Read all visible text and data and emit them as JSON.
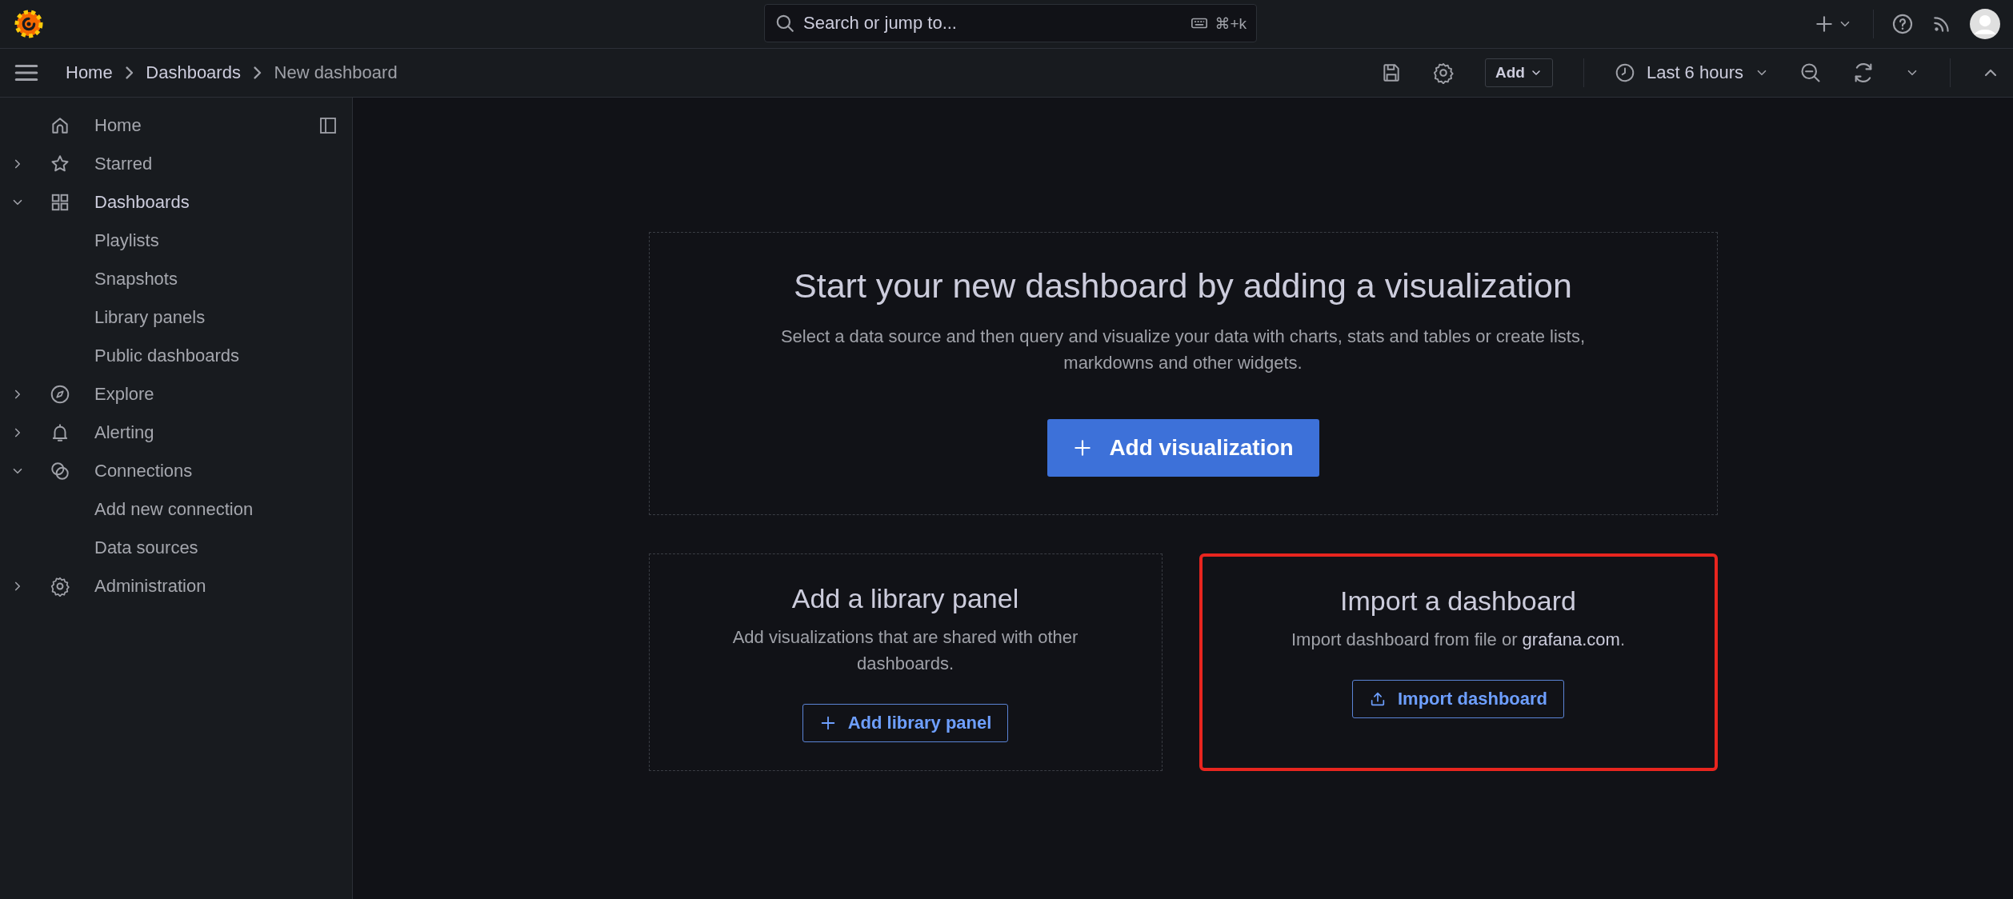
{
  "topbar": {
    "search": {
      "placeholder": "Search or jump to...",
      "shortcut": "⌘+k"
    }
  },
  "navbar": {
    "breadcrumbs": [
      {
        "label": "Home",
        "current": false
      },
      {
        "label": "Dashboards",
        "current": false
      },
      {
        "label": "New dashboard",
        "current": true
      }
    ],
    "add_button": "Add",
    "time_range": "Last 6 hours"
  },
  "sidebar": {
    "items": [
      {
        "label": "Home",
        "kind": "link"
      },
      {
        "label": "Starred",
        "kind": "section",
        "expanded": false
      },
      {
        "label": "Dashboards",
        "kind": "section",
        "expanded": true,
        "selected": true,
        "children": [
          {
            "label": "Playlists"
          },
          {
            "label": "Snapshots"
          },
          {
            "label": "Library panels"
          },
          {
            "label": "Public dashboards"
          }
        ]
      },
      {
        "label": "Explore",
        "kind": "section",
        "expanded": false
      },
      {
        "label": "Alerting",
        "kind": "section",
        "expanded": false
      },
      {
        "label": "Connections",
        "kind": "section",
        "expanded": true,
        "children": [
          {
            "label": "Add new connection"
          },
          {
            "label": "Data sources"
          }
        ]
      },
      {
        "label": "Administration",
        "kind": "section",
        "expanded": false
      }
    ]
  },
  "main": {
    "hero": {
      "title": "Start your new dashboard by adding a visualization",
      "description": "Select a data source and then query and visualize your data with charts, stats and tables or create lists, markdowns and other widgets.",
      "button": "Add visualization"
    },
    "cards": [
      {
        "title": "Add a library panel",
        "description": "Add visualizations that are shared with other dashboards.",
        "button": "Add library panel",
        "kind": "add",
        "highlighted": false
      },
      {
        "title": "Import a dashboard",
        "description": "Import dashboard from file or ",
        "link": "grafana.com",
        "description_end": ".",
        "button": "Import dashboard",
        "kind": "import",
        "highlighted": true
      }
    ]
  }
}
